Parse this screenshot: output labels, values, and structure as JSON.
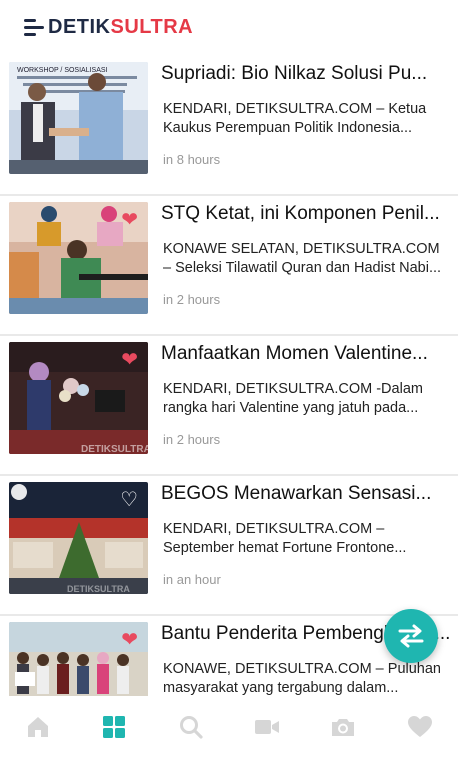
{
  "header": {
    "logo_part1": "DETIK",
    "logo_part2": "SULTRA",
    "brand_dark": "#1f2a44",
    "brand_red": "#e53946"
  },
  "articles": [
    {
      "title": "Supriadi: Bio Nilkaz Solusi Pu...",
      "excerpt": "KENDARI, DETIKSULTRA.COM – Ketua Kaukus Perempuan Politik Indonesia...",
      "time": "in 8 hours",
      "favorite": "none",
      "thumb_banner": "WORKSHOP / SOSIALISASI"
    },
    {
      "title": "STQ Ketat, ini Komponen Penil...",
      "excerpt": "KONAWE SELATAN, DETIKSULTRA.COM – Seleksi Tilawatil Quran dan Hadist Nabi...",
      "time": "in 2 hours",
      "favorite": "on"
    },
    {
      "title": "Manfaatkan Momen Valentine...",
      "excerpt": "KENDARI, DETIKSULTRA.COM -Dalam rangka hari Valentine yang jatuh pada...",
      "time": "in 2 hours",
      "favorite": "on",
      "thumb_watermark": "DETIKSULTRA"
    },
    {
      "title": "BEGOS Menawarkan Sensasi...",
      "excerpt": "KENDARI, DETIKSULTRA.COM – September hemat Fortune Frontone...",
      "time": "in an hour",
      "favorite": "off",
      "thumb_watermark": "DETIKSULTRA"
    },
    {
      "title": "Bantu Penderita Pembengkakan...",
      "excerpt": "KONAWE, DETIKSULTRA.COM – Puluhan masyarakat yang tergabung dalam...",
      "time": "",
      "favorite": "on"
    }
  ],
  "fab": {
    "icon": "swap-arrows-icon",
    "color": "#1fb6b0"
  },
  "bottom_nav": {
    "items": [
      "home-icon",
      "grid-icon",
      "search-icon",
      "video-icon",
      "camera-icon",
      "heart-icon"
    ],
    "active": "grid-icon",
    "active_color": "#1fb6b0",
    "inactive_color": "#d6d6d6"
  }
}
